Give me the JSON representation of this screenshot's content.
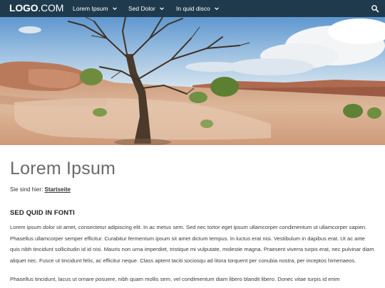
{
  "header": {
    "logo_bold": "LOGO",
    "logo_rest": ".COM",
    "nav": [
      {
        "label": "Lorem Ipsum"
      },
      {
        "label": "Sed Dolor"
      },
      {
        "label": "In quid disco"
      }
    ]
  },
  "colors": {
    "navbar": "#1f3a4d",
    "title": "#6a6a6a"
  },
  "icons": {
    "search": "search-icon",
    "chevron": "chevron-down-icon"
  },
  "main": {
    "title": "Lorem Ipsum",
    "breadcrumb_prefix": "Sie sind hier:",
    "breadcrumb_link": "Startseite",
    "section_heading": "SED QUID IN FONTI",
    "paragraph_1": "Lorem ipsum dolor sit amet, consectetur adipiscing elit. In ac metus sem. Sed nec tortor eget ipsum ullamcorper condimentum ut ullamcorper sapien. Phasellus ullamcorper semper efficitur. Curabitur fermentum ipsum sit amet dictum tempus. In luctus erat nisi. Vestibulum in dapibus erat. Ut ac ante quis nibh tincidunt sollicitudin id id nisi. Mauris non urna imperdiet, tristique mi vulputate, molestie magna. Praesent viverra turpis erat, nec pulvinar diam aliquet nec. Fusce ut tincidunt felis, ac efficitur neque. Class aptent taciti sociosqu ad litora torquent per conubia nostra, per inceptos himenaeos.",
    "paragraph_2": "Phasellus tincidunt, lacus ut ornare posuere, nibh quam mollis sem, vel condimentum diam libero blandit libero. Donec vitae turpis id enim"
  }
}
